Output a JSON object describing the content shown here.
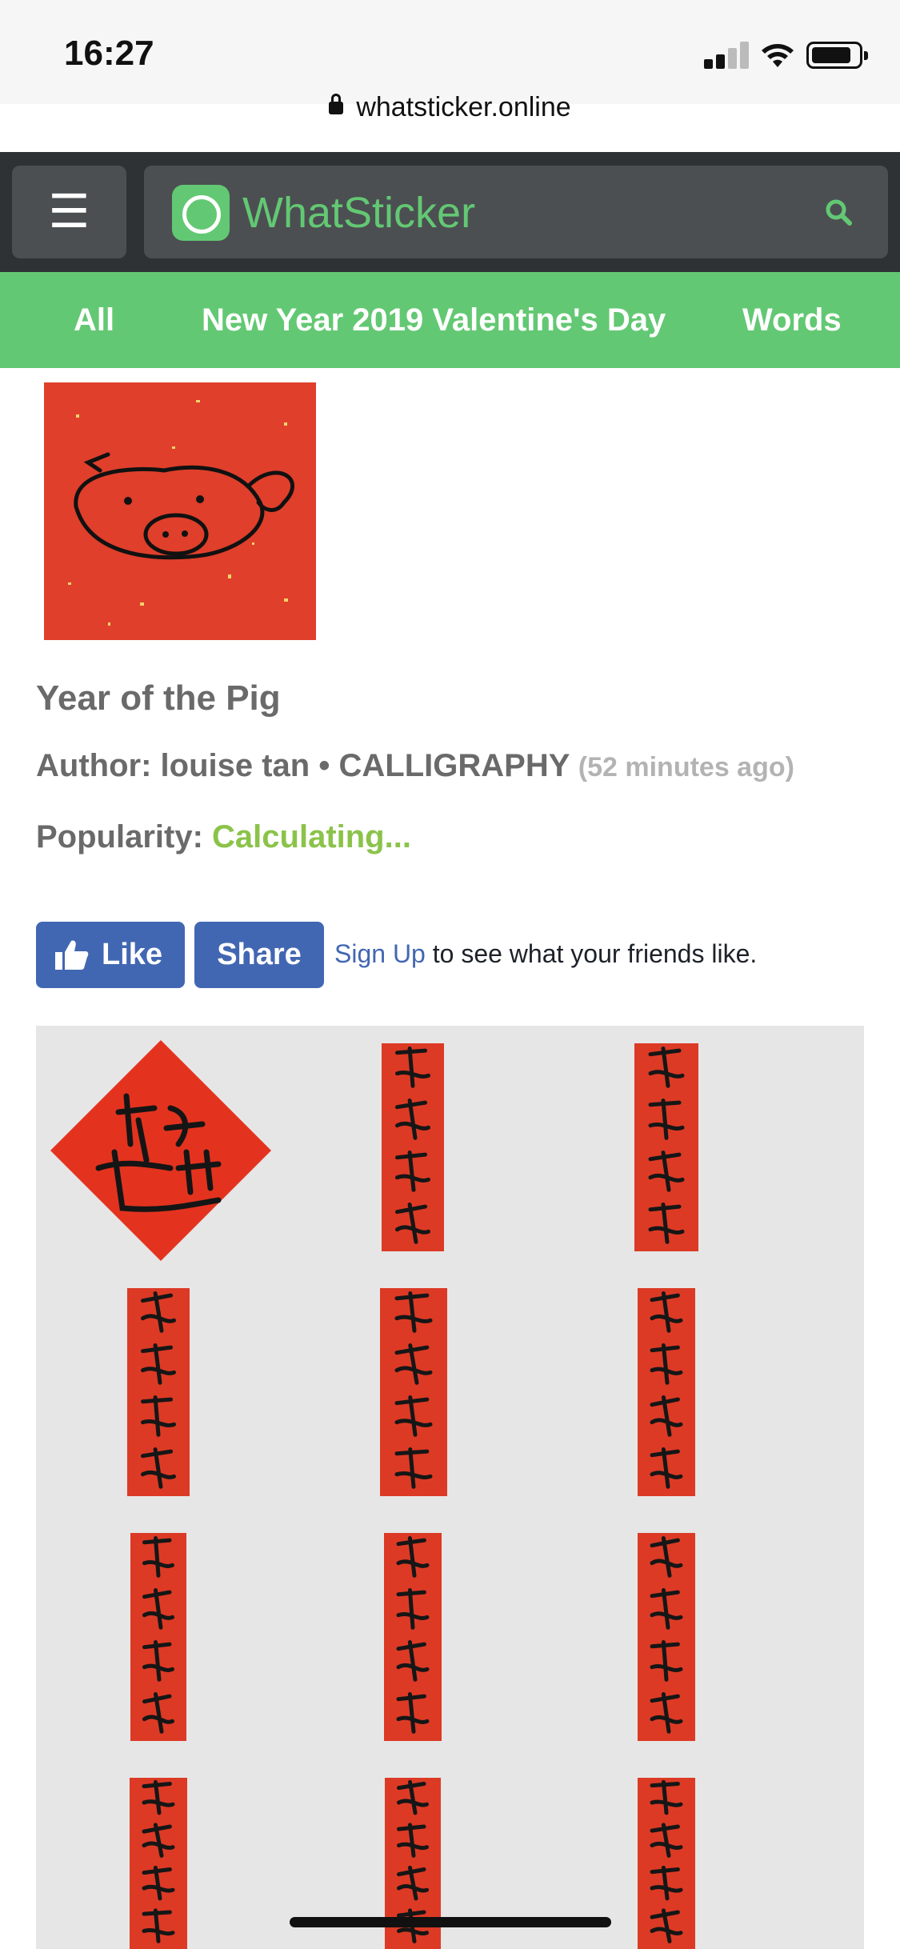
{
  "status_bar": {
    "time": "16:27",
    "url": "whatsticker.online"
  },
  "header": {
    "menu_icon": "hamburger-icon",
    "brand": "WhatSticker",
    "search_icon": "search-icon"
  },
  "nav": {
    "items": [
      "All",
      "New Year 2019 Valentine's Day",
      "Words"
    ]
  },
  "sticker": {
    "title": "Year of the Pig",
    "author_label": "Author:",
    "author": "louise tan",
    "separator": "•",
    "pack": "CALLIGRAPHY",
    "time_ago": "(52 minutes ago)",
    "popularity_label": "Popularity:",
    "popularity_value": "Calculating..."
  },
  "facebook": {
    "like_label": "Like",
    "share_label": "Share",
    "signup_link": "Sign Up",
    "signup_text": " to see what your friends like."
  },
  "colors": {
    "brand_green": "#63c873",
    "header_dark": "#2f3234",
    "sticker_red": "#df3f2b",
    "facebook_blue": "#4267b2"
  }
}
